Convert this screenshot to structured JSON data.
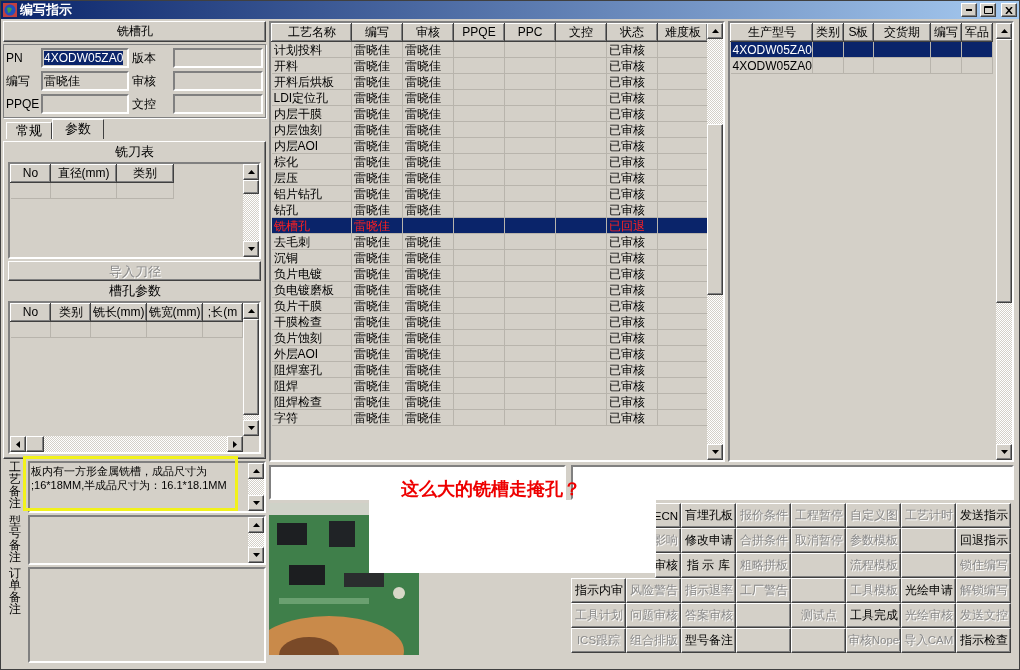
{
  "window": {
    "title": "编写指示"
  },
  "left_panel": {
    "header": "铣槽孔",
    "fields": [
      {
        "label": "PN",
        "value": "4XODW05ZA0",
        "highlighted": true
      },
      {
        "label": "版本"
      },
      {
        "label": "编写",
        "value": "雷晓佳",
        "highlighted": false
      },
      {
        "label": "审核"
      },
      {
        "label": "PPQE"
      },
      {
        "label": "文控"
      }
    ],
    "tabs": [
      {
        "label": "常规",
        "selected": false
      },
      {
        "label": "参数",
        "selected": true
      }
    ],
    "cutter_table": {
      "title": "铣刀表",
      "columns": [
        "No",
        "直径(mm)",
        "类别"
      ]
    },
    "import_button": {
      "label": "导入刀径",
      "disabled": true
    },
    "slot_table": {
      "title": "槽孔参数",
      "columns": [
        "No",
        "类别",
        "铣长(mm)",
        "铣宽(mm)",
        ";长(m"
      ]
    },
    "remarks": [
      {
        "label": "工艺备注",
        "lines": [
          "板内有一方形金属铣槽，成品尺寸为",
          ";16*18MM,半成品尺寸为：16.1*18.1MM"
        ]
      },
      {
        "label": "型号备注"
      },
      {
        "label": "订单备注"
      }
    ]
  },
  "process_table": {
    "columns": [
      "工艺名称",
      "编写",
      "审核",
      "PPQE",
      "PPC",
      "文控",
      "状态",
      "难度板"
    ],
    "rows": [
      {
        "name": "计划投料",
        "writer": "雷晓佳",
        "reviewer": "雷晓佳",
        "status": "已审核",
        "selected": false,
        "returned": false
      },
      {
        "name": "开料",
        "writer": "雷晓佳",
        "reviewer": "雷晓佳",
        "status": "已审核",
        "selected": false,
        "returned": false
      },
      {
        "name": "开料后烘板",
        "writer": "雷晓佳",
        "reviewer": "雷晓佳",
        "status": "已审核",
        "selected": false,
        "returned": false
      },
      {
        "name": "LDI定位孔",
        "writer": "雷晓佳",
        "reviewer": "雷晓佳",
        "status": "已审核",
        "selected": false,
        "returned": false
      },
      {
        "name": "内层干膜",
        "writer": "雷晓佳",
        "reviewer": "雷晓佳",
        "status": "已审核",
        "selected": false,
        "returned": false
      },
      {
        "name": "内层蚀刻",
        "writer": "雷晓佳",
        "reviewer": "雷晓佳",
        "status": "已审核",
        "selected": false,
        "returned": false
      },
      {
        "name": "内层AOI",
        "writer": "雷晓佳",
        "reviewer": "雷晓佳",
        "status": "已审核",
        "selected": false,
        "returned": false
      },
      {
        "name": "棕化",
        "writer": "雷晓佳",
        "reviewer": "雷晓佳",
        "status": "已审核",
        "selected": false,
        "returned": false
      },
      {
        "name": "层压",
        "writer": "雷晓佳",
        "reviewer": "雷晓佳",
        "status": "已审核",
        "selected": false,
        "returned": false
      },
      {
        "name": "铝片钻孔",
        "writer": "雷晓佳",
        "reviewer": "雷晓佳",
        "status": "已审核",
        "selected": false,
        "returned": false
      },
      {
        "name": "钻孔",
        "writer": "雷晓佳",
        "reviewer": "雷晓佳",
        "status": "已审核",
        "selected": false,
        "returned": false
      },
      {
        "name": "铣槽孔",
        "writer": "雷晓佳",
        "status": "已回退",
        "selected": true,
        "returned": true
      },
      {
        "name": "去毛刺",
        "writer": "雷晓佳",
        "reviewer": "雷晓佳",
        "status": "已审核",
        "selected": false,
        "returned": false
      },
      {
        "name": "沉铜",
        "writer": "雷晓佳",
        "reviewer": "雷晓佳",
        "status": "已审核",
        "selected": false,
        "returned": false
      },
      {
        "name": "负片电镀",
        "writer": "雷晓佳",
        "reviewer": "雷晓佳",
        "status": "已审核",
        "selected": false,
        "returned": false
      },
      {
        "name": "负电镀磨板",
        "writer": "雷晓佳",
        "reviewer": "雷晓佳",
        "status": "已审核",
        "selected": false,
        "returned": false
      },
      {
        "name": "负片干膜",
        "writer": "雷晓佳",
        "reviewer": "雷晓佳",
        "status": "已审核",
        "selected": false,
        "returned": false
      },
      {
        "name": "干膜检查",
        "writer": "雷晓佳",
        "reviewer": "雷晓佳",
        "status": "已审核",
        "selected": false,
        "returned": false
      },
      {
        "name": "负片蚀刻",
        "writer": "雷晓佳",
        "reviewer": "雷晓佳",
        "status": "已审核",
        "selected": false,
        "returned": false
      },
      {
        "name": "外层AOI",
        "writer": "雷晓佳",
        "reviewer": "雷晓佳",
        "status": "已审核",
        "selected": false,
        "returned": false
      },
      {
        "name": "阻焊塞孔",
        "writer": "雷晓佳",
        "reviewer": "雷晓佳",
        "status": "已审核",
        "selected": false,
        "returned": false
      },
      {
        "name": "阻焊",
        "writer": "雷晓佳",
        "reviewer": "雷晓佳",
        "status": "已审核",
        "selected": false,
        "returned": false
      },
      {
        "name": "阻焊检查",
        "writer": "雷晓佳",
        "reviewer": "雷晓佳",
        "status": "已审核",
        "selected": false,
        "returned": false
      },
      {
        "name": "字符",
        "writer": "雷晓佳",
        "reviewer": "雷晓佳",
        "status": "已审核",
        "selected": false,
        "returned": false
      }
    ]
  },
  "order_table": {
    "columns": [
      "生产型号",
      "类别",
      "S板",
      "交货期",
      "编写",
      "军品"
    ],
    "rows": [
      {
        "model": "4XODW05ZA0",
        "selected": true
      },
      {
        "model": "4XODW05ZA0",
        "selected": false
      }
    ]
  },
  "annotation": {
    "text": "这么大的铣槽走掩孔？"
  },
  "photo": {
    "kind": "picture"
  },
  "commands": [
    [
      {
        "kind": "partial",
        "label": "ECN",
        "disabled": false
      },
      {
        "kind": "button",
        "label": "盲埋孔板",
        "disabled": false
      },
      {
        "kind": "button",
        "label": "报价条件",
        "disabled": true
      },
      {
        "kind": "button",
        "label": "工程暂停",
        "disabled": true
      },
      {
        "kind": "button",
        "label": "自定义图",
        "disabled": true
      },
      {
        "kind": "button",
        "label": "工艺计时",
        "disabled": true
      },
      {
        "kind": "button",
        "label": "发送指示",
        "disabled": false
      }
    ],
    [
      {
        "kind": "partial",
        "label": "影响",
        "disabled": true
      },
      {
        "kind": "button",
        "label": "修改申请",
        "disabled": false
      },
      {
        "kind": "button",
        "label": "合拼条件",
        "disabled": true
      },
      {
        "kind": "button",
        "label": "取消暂停",
        "disabled": true
      },
      {
        "kind": "button",
        "label": "参数模板",
        "disabled": true
      },
      {
        "kind": "blank"
      },
      {
        "kind": "button",
        "label": "回退指示",
        "disabled": false
      }
    ],
    [
      {
        "kind": "partial",
        "label": "审核",
        "disabled": false
      },
      {
        "kind": "button",
        "label": "指 示 库",
        "disabled": false
      },
      {
        "kind": "button",
        "label": "粗略拼板",
        "disabled": true
      },
      {
        "kind": "blank"
      },
      {
        "kind": "button",
        "label": "流程模板",
        "disabled": true
      },
      {
        "kind": "blank"
      },
      {
        "kind": "button",
        "label": "锁住编写",
        "disabled": true
      }
    ],
    [
      {
        "kind": "button",
        "label": "指示内审",
        "disabled": false
      },
      {
        "kind": "button",
        "label": "风险警告",
        "disabled": true
      },
      {
        "kind": "button",
        "label": "指示退率",
        "disabled": true
      },
      {
        "kind": "button",
        "label": "工厂警告",
        "disabled": true
      },
      {
        "kind": "blank"
      },
      {
        "kind": "button",
        "label": "工具模板",
        "disabled": true
      },
      {
        "kind": "button",
        "label": "光绘申请",
        "disabled": false
      },
      {
        "kind": "button",
        "label": "解锁编写",
        "disabled": true
      }
    ],
    [
      {
        "kind": "button",
        "label": "工具计划",
        "disabled": true
      },
      {
        "kind": "button",
        "label": "问题审核",
        "disabled": true
      },
      {
        "kind": "button",
        "label": "答案审核",
        "disabled": true
      },
      {
        "kind": "blank"
      },
      {
        "kind": "button",
        "label": "测试点",
        "disabled": true
      },
      {
        "kind": "button",
        "label": "工具完成",
        "disabled": false
      },
      {
        "kind": "button",
        "label": "光绘审核",
        "disabled": true
      },
      {
        "kind": "button",
        "label": "发送文控",
        "disabled": true
      }
    ],
    [
      {
        "kind": "button",
        "label": "ICS跟踪",
        "disabled": true
      },
      {
        "kind": "button",
        "label": "组合排版",
        "disabled": true
      },
      {
        "kind": "button",
        "label": "型号备注",
        "disabled": false
      },
      {
        "kind": "blank"
      },
      {
        "kind": "blank"
      },
      {
        "kind": "button",
        "label": "审核Nope",
        "disabled": true
      },
      {
        "kind": "button",
        "label": "导入CAM",
        "disabled": true
      },
      {
        "kind": "button",
        "label": "指示检查",
        "disabled": false
      }
    ]
  ]
}
